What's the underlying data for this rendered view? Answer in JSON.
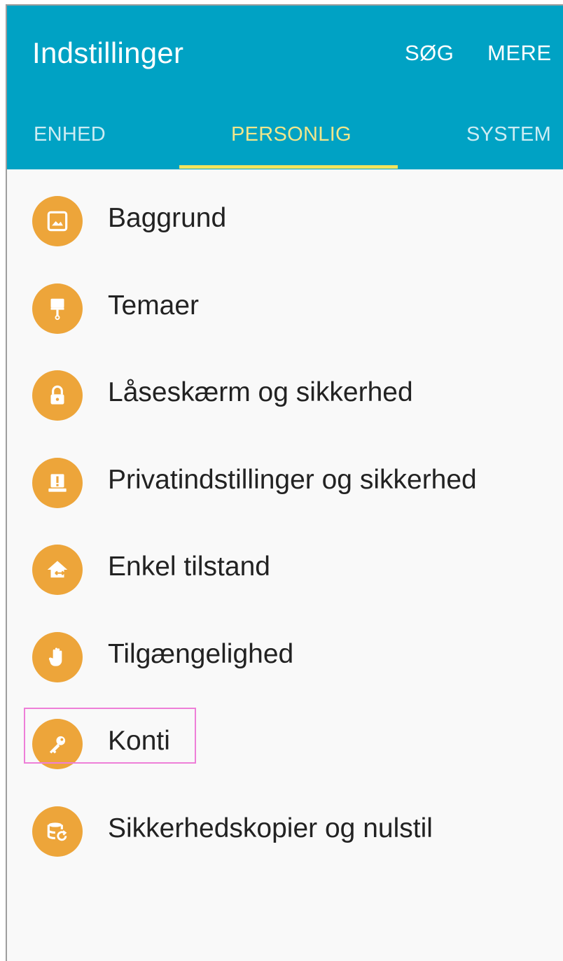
{
  "header": {
    "title": "Indstillinger",
    "actions": {
      "search_label": "SØG",
      "more_label": "MERE"
    }
  },
  "tabs": [
    {
      "label": "ENHED",
      "selected": false
    },
    {
      "label": "PERSONLIG",
      "selected": true
    },
    {
      "label": "SYSTEM",
      "selected": false
    }
  ],
  "list": {
    "items": [
      {
        "label": "Baggrund",
        "icon": "wallpaper-icon"
      },
      {
        "label": "Temaer",
        "icon": "paint-roller-icon"
      },
      {
        "label": "Låseskærm og sikkerhed",
        "icon": "lock-icon"
      },
      {
        "label": "Privatindstillinger og sikkerhed",
        "icon": "privacy-alert-icon"
      },
      {
        "label": "Enkel tilstand",
        "icon": "home-arrows-icon"
      },
      {
        "label": "Tilgængelighed",
        "icon": "hand-icon"
      },
      {
        "label": "Konti",
        "icon": "key-icon",
        "highlighted": true
      },
      {
        "label": "Sikkerhedskopier og nulstil",
        "icon": "backup-restore-icon"
      }
    ]
  },
  "colors": {
    "appbar": "#00a2c4",
    "tab_active": "#f3e45d",
    "icon_bg": "#eda53a",
    "highlight_border": "#ee7fd8",
    "background": "#f9f9f9"
  }
}
